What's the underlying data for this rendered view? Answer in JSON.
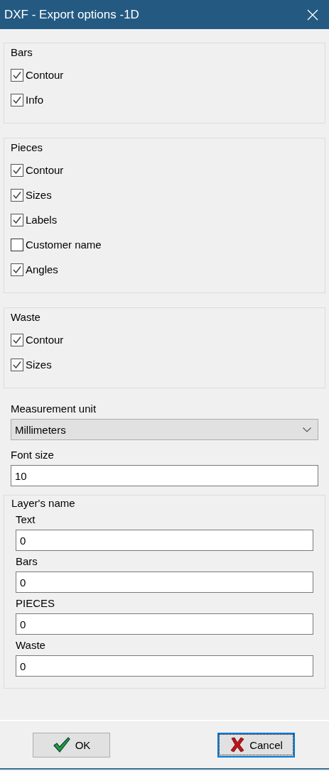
{
  "window": {
    "title": "DXF - Export options -1D"
  },
  "groups": [
    {
      "title": "Bars",
      "options": [
        {
          "label": "Contour",
          "checked": true
        },
        {
          "label": "Info",
          "checked": true
        }
      ]
    },
    {
      "title": "Pieces",
      "options": [
        {
          "label": "Contour",
          "checked": true
        },
        {
          "label": "Sizes",
          "checked": true
        },
        {
          "label": "Labels",
          "checked": true
        },
        {
          "label": "Customer name",
          "checked": false
        },
        {
          "label": "Angles",
          "checked": true
        }
      ]
    },
    {
      "title": "Waste",
      "options": [
        {
          "label": "Contour",
          "checked": true
        },
        {
          "label": "Sizes",
          "checked": true
        }
      ]
    }
  ],
  "measurement_unit": {
    "label": "Measurement unit",
    "value": "Millimeters"
  },
  "font_size": {
    "label": "Font size",
    "value": "10"
  },
  "layers": {
    "title": "Layer's name",
    "fields": [
      {
        "label": "Text",
        "value": "0"
      },
      {
        "label": "Bars",
        "value": "0"
      },
      {
        "label": "PIECES",
        "value": "0"
      },
      {
        "label": "Waste",
        "value": "0"
      }
    ]
  },
  "buttons": [
    {
      "kind": "ok",
      "label": "OK",
      "focused": false
    },
    {
      "kind": "cancel",
      "label": "Cancel",
      "focused": true
    }
  ]
}
